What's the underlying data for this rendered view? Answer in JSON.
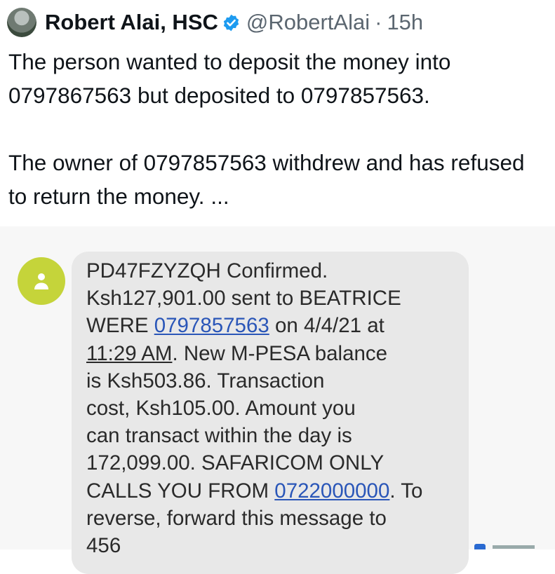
{
  "tweet": {
    "author_name": "Robert Alai, HSC",
    "handle": "@RobertAlai",
    "separator": "·",
    "time_ago": "15h",
    "paragraph1": "The person wanted to deposit the money into 0797867563 but deposited to 0797857563.",
    "paragraph2": "The owner of 0797857563 withdrew and has refused to return the money. ..."
  },
  "sms": {
    "line1": "PD47FZYZQH Confirmed.",
    "line2": "Ksh127,901.00 sent to BEATRICE",
    "line3_pre": "WERE ",
    "line3_link": "0797857563",
    "line3_post": " on 4/4/21 at",
    "line4_time": "11:29 AM",
    "line4_post": ". New M-PESA balance",
    "line5": "is Ksh503.86. Transaction",
    "line6": "cost, Ksh105.00. Amount you",
    "line7": "can transact within the day is",
    "line8": "172,099.00. SAFARICOM ONLY",
    "line9_pre": "CALLS YOU FROM ",
    "line9_link": "0722000000",
    "line9_post": ". To",
    "line10": "reverse, forward this message to",
    "line11": "456"
  },
  "colors": {
    "link": "#2a56b8",
    "verified_badge": "#1d9bf0",
    "sender_avatar": "#c5d43a",
    "bubble": "#e8e8e8"
  }
}
